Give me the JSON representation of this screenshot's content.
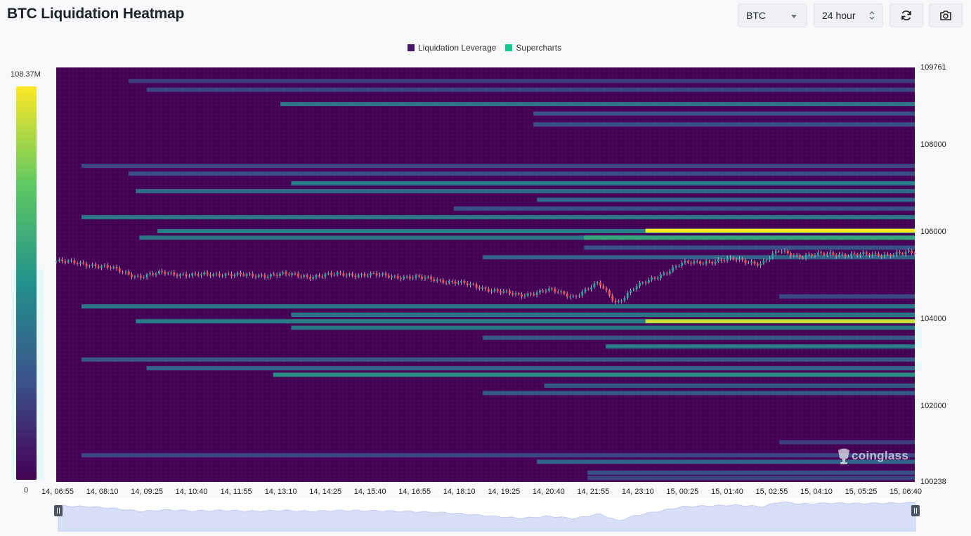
{
  "header": {
    "title": "BTC Liquidation Heatmap",
    "symbol_value": "BTC",
    "interval_value": "24 hour"
  },
  "toolbar": {
    "refresh_icon": "refresh-icon",
    "camera_icon": "camera-icon"
  },
  "legend": [
    {
      "label": "Liquidation Leverage",
      "color": "#4a1668"
    },
    {
      "label": "Supercharts",
      "color": "#15c98a"
    }
  ],
  "colorbar": {
    "max_label": "108.37M",
    "min_label": "0"
  },
  "watermark": "coinglass",
  "chart_data": {
    "type": "heatmap",
    "title": "BTC Liquidation Heatmap",
    "x_ticks": [
      "14, 06:55",
      "14, 08:10",
      "14, 09:25",
      "14, 10:40",
      "14, 11:55",
      "14, 13:10",
      "14, 14:25",
      "14, 15:40",
      "14, 16:55",
      "14, 18:10",
      "14, 19:25",
      "14, 20:40",
      "14, 21:55",
      "14, 23:10",
      "15, 00:25",
      "15, 01:40",
      "15, 02:55",
      "15, 04:10",
      "15, 05:25",
      "15, 06:40"
    ],
    "y_ticks": [
      109761,
      108000,
      106000,
      104000,
      102000,
      100238
    ],
    "ylim": [
      100238,
      109761
    ],
    "x_range_hours": [
      0,
      23.75
    ],
    "colorscale": [
      "#440154",
      "#3b528b",
      "#21918c",
      "#5ec962",
      "#fde725"
    ],
    "value_range_millions": [
      0,
      108.37
    ],
    "liquidation_bands": [
      {
        "price": 109450,
        "start_h": 2.0,
        "intensity": 0.25
      },
      {
        "price": 109250,
        "start_h": 2.5,
        "intensity": 0.3
      },
      {
        "price": 108920,
        "start_h": 6.2,
        "intensity": 0.55
      },
      {
        "price": 108700,
        "start_h": 13.2,
        "intensity": 0.35
      },
      {
        "price": 108450,
        "start_h": 13.2,
        "intensity": 0.35
      },
      {
        "price": 107500,
        "start_h": 0.7,
        "intensity": 0.3
      },
      {
        "price": 107320,
        "start_h": 2.0,
        "intensity": 0.35
      },
      {
        "price": 107100,
        "start_h": 6.5,
        "intensity": 0.6
      },
      {
        "price": 106920,
        "start_h": 2.2,
        "intensity": 0.5
      },
      {
        "price": 106720,
        "start_h": 13.3,
        "intensity": 0.45
      },
      {
        "price": 106520,
        "start_h": 11.0,
        "intensity": 0.35
      },
      {
        "price": 106320,
        "start_h": 0.7,
        "intensity": 0.55
      },
      {
        "price": 106000,
        "start_h": 2.8,
        "intensity": 0.6
      },
      {
        "price": 106010,
        "start_h": 16.3,
        "intensity": 1.0
      },
      {
        "price": 105850,
        "start_h": 2.3,
        "intensity": 0.55
      },
      {
        "price": 105850,
        "start_h": 14.6,
        "intensity": 0.8
      },
      {
        "price": 105620,
        "start_h": 14.6,
        "intensity": 0.35
      },
      {
        "price": 105400,
        "start_h": 11.8,
        "intensity": 0.45
      },
      {
        "price": 104500,
        "start_h": 20.0,
        "intensity": 0.3
      },
      {
        "price": 104270,
        "start_h": 0.7,
        "intensity": 0.55
      },
      {
        "price": 104080,
        "start_h": 6.5,
        "intensity": 0.55
      },
      {
        "price": 103930,
        "start_h": 2.2,
        "intensity": 0.6
      },
      {
        "price": 103930,
        "start_h": 16.3,
        "intensity": 0.93
      },
      {
        "price": 103780,
        "start_h": 6.5,
        "intensity": 0.55
      },
      {
        "price": 103550,
        "start_h": 11.8,
        "intensity": 0.4
      },
      {
        "price": 103350,
        "start_h": 15.2,
        "intensity": 0.6
      },
      {
        "price": 103050,
        "start_h": 0.7,
        "intensity": 0.4
      },
      {
        "price": 102850,
        "start_h": 2.5,
        "intensity": 0.45
      },
      {
        "price": 102700,
        "start_h": 6.0,
        "intensity": 0.7
      },
      {
        "price": 102450,
        "start_h": 13.5,
        "intensity": 0.4
      },
      {
        "price": 102280,
        "start_h": 11.8,
        "intensity": 0.4
      },
      {
        "price": 101150,
        "start_h": 20.0,
        "intensity": 0.25
      },
      {
        "price": 100850,
        "start_h": 0.7,
        "intensity": 0.3
      },
      {
        "price": 100700,
        "start_h": 13.3,
        "intensity": 0.45
      },
      {
        "price": 100450,
        "start_h": 14.7,
        "intensity": 0.35
      },
      {
        "price": 100330,
        "start_h": 14.7,
        "intensity": 0.3
      }
    ],
    "price_path": [
      {
        "h": 0,
        "p": 105310
      },
      {
        "h": 0.8,
        "p": 105250
      },
      {
        "h": 1.5,
        "p": 105150
      },
      {
        "h": 2.3,
        "p": 104950
      },
      {
        "h": 3.0,
        "p": 105050
      },
      {
        "h": 3.8,
        "p": 104980
      },
      {
        "h": 4.6,
        "p": 105020
      },
      {
        "h": 5.4,
        "p": 104970
      },
      {
        "h": 6.2,
        "p": 105010
      },
      {
        "h": 7.0,
        "p": 104960
      },
      {
        "h": 7.9,
        "p": 105010
      },
      {
        "h": 8.8,
        "p": 104990
      },
      {
        "h": 9.6,
        "p": 104950
      },
      {
        "h": 10.4,
        "p": 104900
      },
      {
        "h": 11.2,
        "p": 104800
      },
      {
        "h": 12.0,
        "p": 104660
      },
      {
        "h": 12.8,
        "p": 104520
      },
      {
        "h": 13.6,
        "p": 104650
      },
      {
        "h": 14.3,
        "p": 104500
      },
      {
        "h": 15.0,
        "p": 104800
      },
      {
        "h": 15.5,
        "p": 104350
      },
      {
        "h": 16.0,
        "p": 104700
      },
      {
        "h": 16.6,
        "p": 104950
      },
      {
        "h": 17.3,
        "p": 105250
      },
      {
        "h": 18.0,
        "p": 105300
      },
      {
        "h": 18.8,
        "p": 105350
      },
      {
        "h": 19.5,
        "p": 105250
      },
      {
        "h": 20.0,
        "p": 105550
      },
      {
        "h": 20.6,
        "p": 105420
      },
      {
        "h": 21.4,
        "p": 105480
      },
      {
        "h": 22.2,
        "p": 105450
      },
      {
        "h": 23.0,
        "p": 105470
      },
      {
        "h": 23.75,
        "p": 105500
      }
    ]
  }
}
